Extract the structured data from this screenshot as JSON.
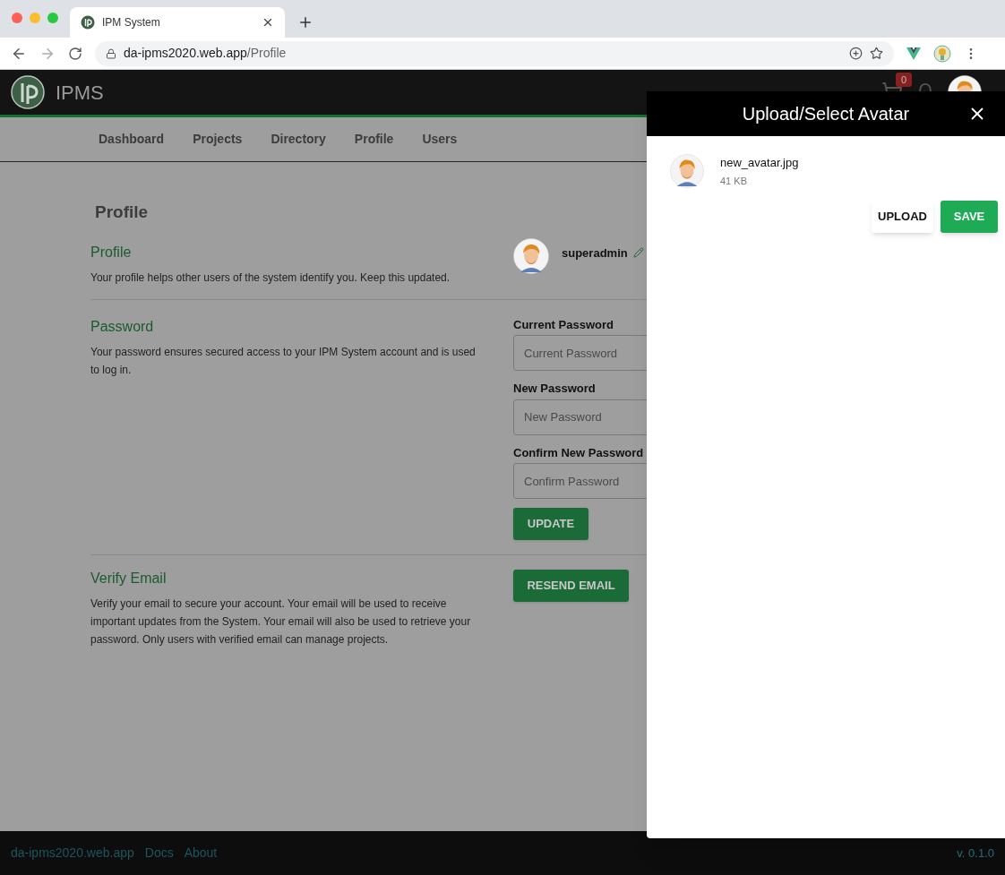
{
  "browser": {
    "tab_title": "IPM System",
    "url_host": "da-ipms2020.web.app",
    "url_path": "/Profile"
  },
  "app": {
    "brand": "IPMS",
    "cart_count": "0"
  },
  "nav": [
    {
      "label": "Dashboard"
    },
    {
      "label": "Projects"
    },
    {
      "label": "Directory"
    },
    {
      "label": "Profile"
    },
    {
      "label": "Users"
    }
  ],
  "page_title": "Profile",
  "profile": {
    "title": "Profile",
    "description": "Your profile helps other users of the system identify you. Keep this updated.",
    "username": "superadmin"
  },
  "password": {
    "title": "Password",
    "description": "Your password ensures secured access to your IPM System account and is used to log in.",
    "fields": [
      {
        "label": "Current Password",
        "placeholder": "Current Password"
      },
      {
        "label": "New Password",
        "placeholder": "New Password"
      },
      {
        "label": "Confirm New Password",
        "placeholder": "Confirm Password"
      }
    ],
    "button": "UPDATE"
  },
  "verify": {
    "title": "Verify Email",
    "description": "Verify your email to secure your account. Your email will be used to receive important updates from the System. Your email will also be used to retrieve your password. Only users with verified email can manage projects.",
    "button": "RESEND EMAIL"
  },
  "footer": {
    "links": [
      "da-ipms2020.web.app",
      "Docs",
      "About"
    ],
    "version": "v. 0.1.0"
  },
  "drawer": {
    "title": "Upload/Select Avatar",
    "file": {
      "name": "new_avatar.jpg",
      "size": "41 KB"
    },
    "buttons": [
      {
        "label": "UPLOAD",
        "kind": "outlined"
      },
      {
        "label": "SAVE",
        "kind": "primary"
      }
    ]
  }
}
